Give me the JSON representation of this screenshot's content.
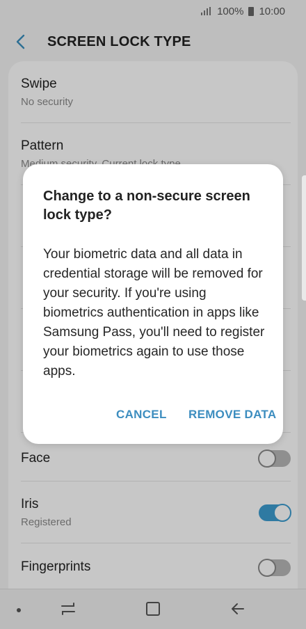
{
  "status_bar": {
    "battery": "100%",
    "time": "10:00"
  },
  "header": {
    "title": "SCREEN LOCK TYPE"
  },
  "lock_types": [
    {
      "title": "Swipe",
      "subtitle": "No security"
    },
    {
      "title": "Pattern",
      "subtitle": "Medium security, Current lock type"
    }
  ],
  "biometrics": [
    {
      "title": "Face",
      "subtitle": "",
      "toggle": "off"
    },
    {
      "title": "Iris",
      "subtitle": "Registered",
      "toggle": "on"
    },
    {
      "title": "Fingerprints",
      "subtitle": "",
      "toggle": "off"
    }
  ],
  "dialog": {
    "title": "Change to a non-secure screen lock type?",
    "body": "Your biometric data and all data in credential storage will be removed for your security. If you're using biometrics authentication in apps like Samsung Pass, you'll need to register your biometrics again to use those apps.",
    "cancel": "CANCEL",
    "confirm": "REMOVE DATA"
  },
  "colors": {
    "accent": "#3c8dbf",
    "toggle_on": "#3d9dd0"
  }
}
